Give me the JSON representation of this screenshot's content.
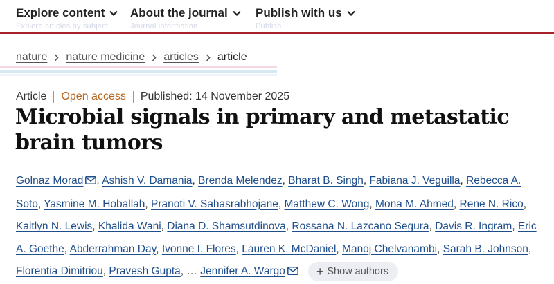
{
  "nav": {
    "items": [
      {
        "label": "Explore content",
        "ghost": "Explore articles by subject"
      },
      {
        "label": "About the journal",
        "ghost": "Journal information"
      },
      {
        "label": "Publish with us",
        "ghost": "Publish"
      }
    ],
    "accent_color": "#a5212b"
  },
  "breadcrumb": {
    "items": [
      "nature",
      "nature medicine",
      "articles"
    ],
    "current": "article"
  },
  "article": {
    "type": "Article",
    "access": "Open access",
    "published": "Published: 14 November 2025",
    "title": "Microbial signals in primary and metastatic brain tumors"
  },
  "authors": [
    "Golnaz Morad",
    "Ashish V. Damania",
    "Brenda Melendez",
    "Bharat B. Singh",
    "Fabiana J. Veguilla",
    "Rebecca A. Soto",
    "Yasmine M. Hoballah",
    "Pranoti V. Sahasrabhojane",
    "Matthew C. Wong",
    "Mona M. Ahmed",
    "Rene N. Rico",
    "Kaitlyn N. Lewis",
    "Khalida Wani",
    "Diana D. Shamsutdinova",
    "Rossana N. Lazcano Segura",
    "Davis R. Ingram",
    "Eric A. Goethe",
    "Abderrahman Day",
    "Ivonne I. Flores",
    "Lauren K. McDaniel",
    "Manoj Chelvanambi",
    "Sarah B. Johnson",
    "Florentia Dimitriou",
    "Pravesh Gupta",
    "Jennifer A. Wargo"
  ],
  "authors_ellipsis": "…",
  "show_authors_label": "Show authors",
  "link_color": "#1f4e8c",
  "open_access_color": "#b5651d"
}
